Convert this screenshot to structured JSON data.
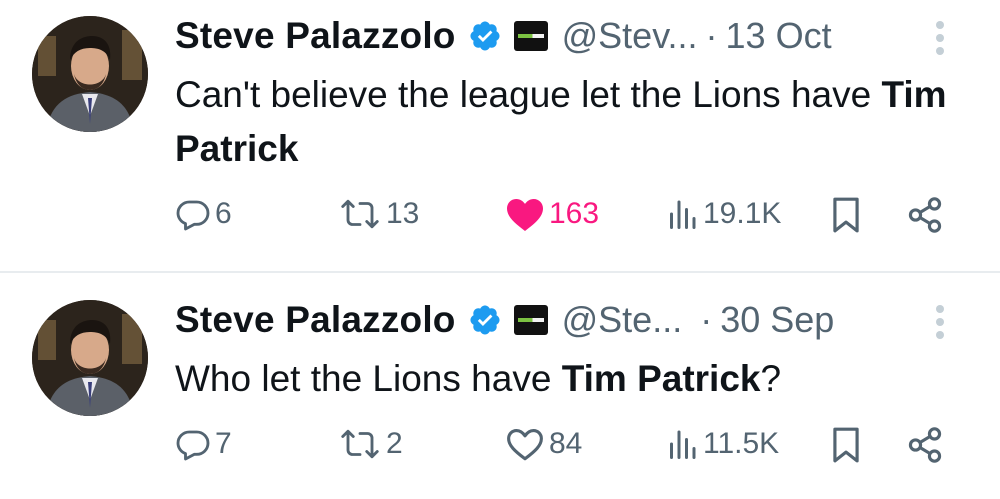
{
  "tweets": [
    {
      "author_name": "Steve Palazzolo",
      "handle": "@Stev...",
      "dot": "·",
      "date": "13 Oct",
      "text_before": "Can't believe the league let the Lions have ",
      "text_bold": "Tim Patrick",
      "text_after": "",
      "replies": "6",
      "retweets": "13",
      "likes": "163",
      "liked": true,
      "views": "19.1K"
    },
    {
      "author_name": "Steve Palazzolo",
      "handle": "@Ste...",
      "dot": "·",
      "date": "30 Sep",
      "text_before": "Who let the Lions have ",
      "text_bold": "Tim Patrick",
      "text_after": "?",
      "replies": "7",
      "retweets": "2",
      "likes": "84",
      "liked": false,
      "views": "11.5K"
    }
  ],
  "colors": {
    "verified_blue": "#1d9bf0",
    "like_pink": "#f91880",
    "secondary_text": "#536471"
  },
  "icons": [
    "verified-badge-icon",
    "reply-icon",
    "retweet-icon",
    "like-icon",
    "views-icon",
    "bookmark-icon",
    "share-icon",
    "more-icon"
  ]
}
